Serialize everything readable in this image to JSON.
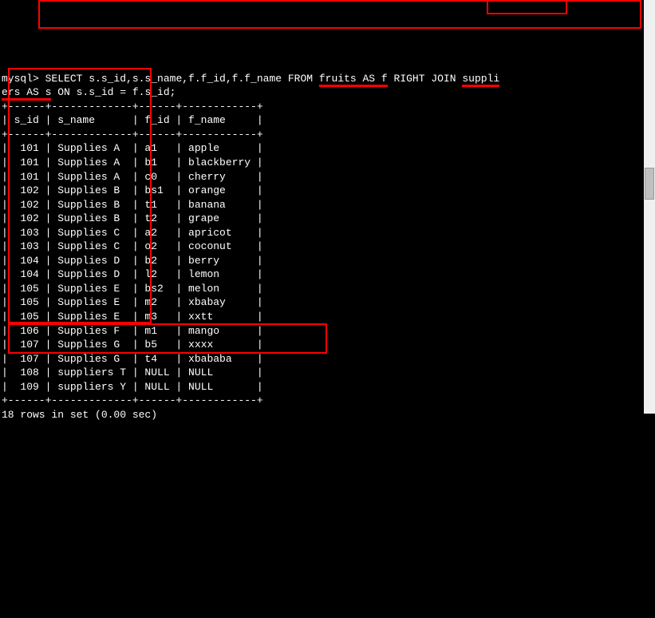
{
  "prompt": "mysql>",
  "query_part1": " SELECT s.s_id,s.s_name,f.f_id,f.f_name FROM ",
  "query_fruits": "fruits AS f",
  "query_space1": " ",
  "query_rightjoin": "RIGHT JOIN",
  "query_space2": " ",
  "query_suppli": "suppli",
  "query_line2a": "ers AS s",
  "query_line2b": " ON s.s_id = f.s_id;",
  "separator": "+------+-------------+------+------------+",
  "header": "| s_id | s_name      | f_id | f_name     |",
  "chart_data": {
    "type": "table",
    "columns": [
      "s_id",
      "s_name",
      "f_id",
      "f_name"
    ],
    "rows": [
      {
        "s_id": "101",
        "s_name": "Supplies A",
        "f_id": "a1",
        "f_name": "apple"
      },
      {
        "s_id": "101",
        "s_name": "Supplies A",
        "f_id": "b1",
        "f_name": "blackberry"
      },
      {
        "s_id": "101",
        "s_name": "Supplies A",
        "f_id": "c0",
        "f_name": "cherry"
      },
      {
        "s_id": "102",
        "s_name": "Supplies B",
        "f_id": "bs1",
        "f_name": "orange"
      },
      {
        "s_id": "102",
        "s_name": "Supplies B",
        "f_id": "t1",
        "f_name": "banana"
      },
      {
        "s_id": "102",
        "s_name": "Supplies B",
        "f_id": "t2",
        "f_name": "grape"
      },
      {
        "s_id": "103",
        "s_name": "Supplies C",
        "f_id": "a2",
        "f_name": "apricot"
      },
      {
        "s_id": "103",
        "s_name": "Supplies C",
        "f_id": "o2",
        "f_name": "coconut"
      },
      {
        "s_id": "104",
        "s_name": "Supplies D",
        "f_id": "b2",
        "f_name": "berry"
      },
      {
        "s_id": "104",
        "s_name": "Supplies D",
        "f_id": "l2",
        "f_name": "lemon"
      },
      {
        "s_id": "105",
        "s_name": "Supplies E",
        "f_id": "bs2",
        "f_name": "melon"
      },
      {
        "s_id": "105",
        "s_name": "Supplies E",
        "f_id": "m2",
        "f_name": "xbabay"
      },
      {
        "s_id": "105",
        "s_name": "Supplies E",
        "f_id": "m3",
        "f_name": "xxtt"
      },
      {
        "s_id": "106",
        "s_name": "Supplies F",
        "f_id": "m1",
        "f_name": "mango"
      },
      {
        "s_id": "107",
        "s_name": "Supplies G",
        "f_id": "b5",
        "f_name": "xxxx"
      },
      {
        "s_id": "107",
        "s_name": "Supplies G",
        "f_id": "t4",
        "f_name": "xbababa"
      },
      {
        "s_id": "108",
        "s_name": "suppliers T",
        "f_id": "NULL",
        "f_name": "NULL"
      },
      {
        "s_id": "109",
        "s_name": "suppliers Y",
        "f_id": "NULL",
        "f_name": "NULL"
      }
    ]
  },
  "r0": "|  101 | Supplies A  | a1   | apple      |",
  "r1": "|  101 | Supplies A  | b1   | blackberry |",
  "r2": "|  101 | Supplies A  | c0   | cherry     |",
  "r3": "|  102 | Supplies B  | bs1  | orange     |",
  "r4": "|  102 | Supplies B  | t1   | banana     |",
  "r5": "|  102 | Supplies B  | t2   | grape      |",
  "r6": "|  103 | Supplies C  | a2   | apricot    |",
  "r7": "|  103 | Supplies C  | o2   | coconut    |",
  "r8": "|  104 | Supplies D  | b2   | berry      |",
  "r9": "|  104 | Supplies D  | l2   | lemon      |",
  "r10": "|  105 | Supplies E  | bs2  | melon      |",
  "r11": "|  105 | Supplies E  | m2   | xbabay     |",
  "r12": "|  105 | Supplies E  | m3   | xxtt       |",
  "r13": "|  106 | Supplies F  | m1   | mango      |",
  "r14": "|  107 | Supplies G  | b5   | xxxx       |",
  "r15": "|  107 | Supplies G  | t4   | xbababa    |",
  "r16": "|  108 | suppliers T | NULL | NULL       |",
  "r17": "|  109 | suppliers Y | NULL | NULL       |",
  "footer": "18 rows in set (0.00 sec)"
}
